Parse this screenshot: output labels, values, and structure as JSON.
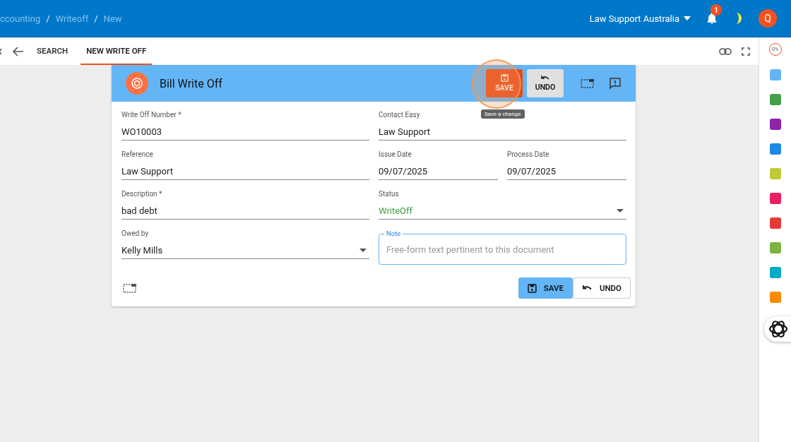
{
  "breadcrumb": [
    {
      "kind": "link",
      "text": "ccounting"
    },
    {
      "kind": "separator",
      "text": "/"
    },
    {
      "kind": "link",
      "text": "Writeoff"
    },
    {
      "kind": "separator",
      "text": "/"
    },
    {
      "kind": "link",
      "text": "New"
    }
  ],
  "topbar": {
    "organization": "Law Support Australia",
    "notification_count": "1",
    "avatar_letter": "Q"
  },
  "tabs": [
    {
      "label": "SEARCH",
      "selected": false
    },
    {
      "label": "NEW WRITE OFF",
      "selected": true
    }
  ],
  "form": {
    "title": "Bill Write Off",
    "header_buttons": [
      "SAVE",
      "UNDO"
    ],
    "tooltip": "Save a change",
    "rows": [
      {
        "fields": [
          {
            "kind": "text",
            "label": "Write Off Number *",
            "value": "WO10003"
          },
          {
            "kind": "text",
            "label": "Contact Easy",
            "value": "Law Support"
          }
        ]
      },
      {
        "fields": [
          {
            "kind": "text",
            "label": "Reference",
            "value": "Law Support"
          },
          {
            "kind": "text",
            "label": "Issue Date",
            "value": "09/07/2025"
          },
          {
            "kind": "text",
            "label": "Process Date",
            "value": "09/07/2025"
          }
        ]
      },
      {
        "fields": [
          {
            "kind": "text",
            "label": "Description *",
            "value": "bad debt"
          },
          {
            "kind": "select",
            "label": "Status",
            "value": "WriteOff",
            "color": "#43a047"
          }
        ]
      },
      {
        "fields": [
          {
            "kind": "select",
            "label": "Owed by",
            "value": "Kelly Mills"
          },
          {
            "kind": "textarea",
            "label": "Note",
            "placeholder": "Free-form text pertinent to this document"
          }
        ]
      }
    ],
    "footer_buttons": [
      "SAVE",
      "UNDO"
    ]
  },
  "sidebar": {
    "progress": "0%"
  }
}
